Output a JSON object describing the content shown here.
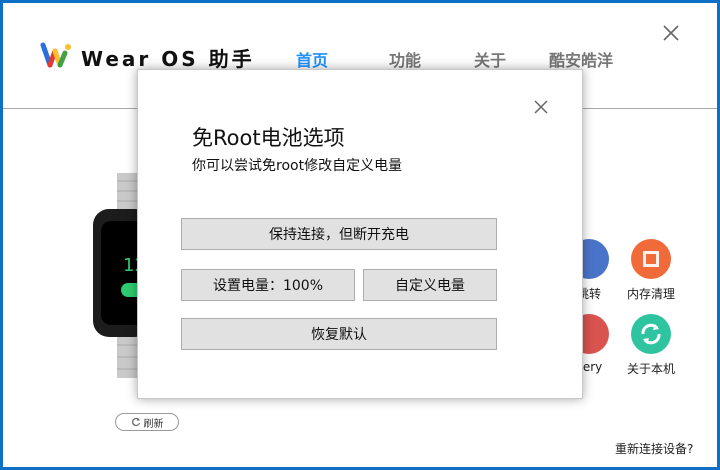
{
  "app": {
    "title": "Wear OS 助手"
  },
  "nav": {
    "tabs": [
      "首页",
      "功能",
      "关于",
      "酷安皓洋"
    ]
  },
  "features": {
    "items": [
      "跳转",
      "内存清理",
      "very",
      "关于本机"
    ]
  },
  "refresh": {
    "label": "刷新"
  },
  "footer": {
    "reconnect": "重新连接设备?"
  },
  "dialog": {
    "title": "免Root电池选项",
    "subtitle": "你可以尝试免root修改自定义电量",
    "buttons": {
      "keep": "保持连接，但断开充电",
      "set": "设置电量：100%",
      "custom": "自定义电量",
      "restore": "恢复默认"
    }
  },
  "colors": {
    "accent": "#1e90ff",
    "frame": "#0f6fc4",
    "watch_green": "#2ecc71"
  }
}
